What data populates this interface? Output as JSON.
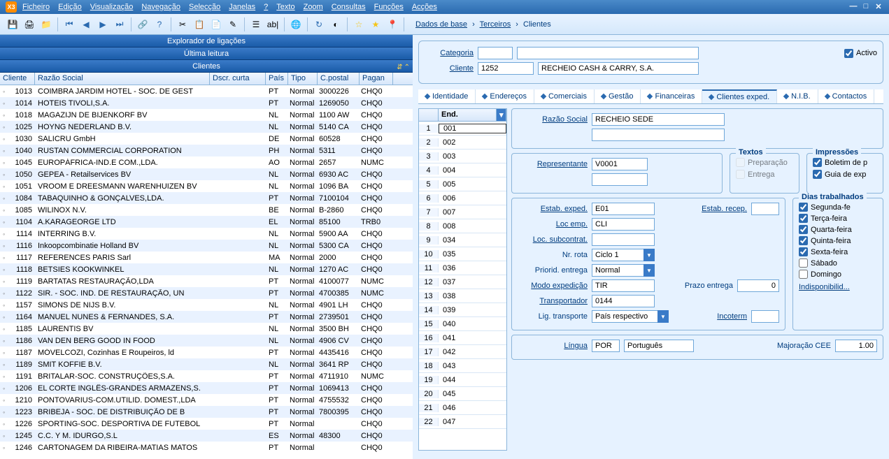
{
  "menu": [
    "Ficheiro",
    "Edição",
    "Visualização",
    "Navegação",
    "Selecção",
    "Janelas",
    "?",
    "Texto",
    "Zoom",
    "Consultas",
    "Funções",
    "Acções"
  ],
  "breadcrumb": {
    "a": "Dados de base",
    "b": "Terceiros",
    "c": "Clientes"
  },
  "leftHeaders": {
    "explorador": "Explorador de ligações",
    "leitura": "Última leitura",
    "clientes": "Clientes"
  },
  "gridCols": {
    "cliente": "Cliente",
    "razao": "Razão Social",
    "dscr": "Dscr. curta",
    "pais": "País",
    "tipo": "Tipo",
    "postal": "C.postal",
    "pagan": "Pagan"
  },
  "rows": [
    {
      "id": "1013",
      "razao": "COIMBRA JARDIM HOTEL - SOC. DE GEST",
      "pais": "PT",
      "tipo": "Normal",
      "postal": "3000226",
      "pag": "CHQ0"
    },
    {
      "id": "1014",
      "razao": "HOTEIS TIVOLI,S.A.",
      "pais": "PT",
      "tipo": "Normal",
      "postal": "1269050",
      "pag": "CHQ0"
    },
    {
      "id": "1018",
      "razao": "MAGAZIJN DE BIJENKORF BV",
      "pais": "NL",
      "tipo": "Normal",
      "postal": "1100 AW",
      "pag": "CHQ0"
    },
    {
      "id": "1025",
      "razao": "HOYNG NEDERLAND B.V.",
      "pais": "NL",
      "tipo": "Normal",
      "postal": "5140  CA",
      "pag": "CHQ0"
    },
    {
      "id": "1030",
      "razao": "SALICRU GmbH",
      "pais": "DE",
      "tipo": "Normal",
      "postal": "60528",
      "pag": "CHQ0"
    },
    {
      "id": "1040",
      "razao": "RUSTAN COMMERCIAL CORPORATION",
      "pais": "PH",
      "tipo": "Normal",
      "postal": "5311",
      "pag": "CHQ0"
    },
    {
      "id": "1045",
      "razao": "EUROPÁFRICA-IND.E COM.,LDA.",
      "pais": "AO",
      "tipo": "Normal",
      "postal": "2657",
      "pag": "NUMC"
    },
    {
      "id": "1050",
      "razao": "GEPEA - Retailservices BV",
      "pais": "NL",
      "tipo": "Normal",
      "postal": "6930 AC",
      "pag": "CHQ0"
    },
    {
      "id": "1051",
      "razao": "VROOM E DREESMANN WARENHUIZEN BV",
      "pais": "NL",
      "tipo": "Normal",
      "postal": "1096 BA",
      "pag": "CHQ0"
    },
    {
      "id": "1084",
      "razao": "TABAQUINHO & GONÇALVES,LDA.",
      "pais": "PT",
      "tipo": "Normal",
      "postal": "7100104",
      "pag": "CHQ0"
    },
    {
      "id": "1085",
      "razao": "WILINOX N.V.",
      "pais": "BE",
      "tipo": "Normal",
      "postal": "B-2860",
      "pag": "CHQ0"
    },
    {
      "id": "1104",
      "razao": "A.KARAGEORGE LTD",
      "pais": "EL",
      "tipo": "Normal",
      "postal": "85100",
      "pag": "TRB0"
    },
    {
      "id": "1114",
      "razao": "INTERRING B.V.",
      "pais": "NL",
      "tipo": "Normal",
      "postal": "5900 AA",
      "pag": "CHQ0"
    },
    {
      "id": "1116",
      "razao": "Inkoopcombinatie Holland BV",
      "pais": "NL",
      "tipo": "Normal",
      "postal": "5300 CA",
      "pag": "CHQ0"
    },
    {
      "id": "1117",
      "razao": "REFERENCES PARIS Sarl",
      "pais": "MA",
      "tipo": "Normal",
      "postal": "2000",
      "pag": "CHQ0"
    },
    {
      "id": "1118",
      "razao": "BETSIES KOOKWINKEL",
      "pais": "NL",
      "tipo": "Normal",
      "postal": "1270 AC",
      "pag": "CHQ0"
    },
    {
      "id": "1119",
      "razao": "BARTATAS RESTAURAÇÃO,LDA",
      "pais": "PT",
      "tipo": "Normal",
      "postal": "4100077",
      "pag": "NUMC"
    },
    {
      "id": "1122",
      "razao": "SIR. - SOC. IND. DE RESTAURAÇÃO, UN",
      "pais": "PT",
      "tipo": "Normal",
      "postal": "4700385",
      "pag": "NUMC"
    },
    {
      "id": "1157",
      "razao": "SIMONS DE NIJS B.V.",
      "pais": "NL",
      "tipo": "Normal",
      "postal": "4901 LH",
      "pag": "CHQ0"
    },
    {
      "id": "1164",
      "razao": "MANUEL NUNES & FERNANDES, S.A.",
      "pais": "PT",
      "tipo": "Normal",
      "postal": "2739501",
      "pag": "CHQ0"
    },
    {
      "id": "1185",
      "razao": "LAURENTIS BV",
      "pais": "NL",
      "tipo": "Normal",
      "postal": "3500 BH",
      "pag": "CHQ0"
    },
    {
      "id": "1186",
      "razao": "VAN DEN BERG  GOOD IN FOOD",
      "pais": "NL",
      "tipo": "Normal",
      "postal": "4906 CV",
      "pag": "CHQ0"
    },
    {
      "id": "1187",
      "razao": "MÓVELCOZI, Cozinhas E Roupeiros, ld",
      "pais": "PT",
      "tipo": "Normal",
      "postal": "4435416",
      "pag": "CHQ0"
    },
    {
      "id": "1189",
      "razao": "SMIT KOFFIE B.V.",
      "pais": "NL",
      "tipo": "Normal",
      "postal": "3641 RP",
      "pag": "CHQ0"
    },
    {
      "id": "1191",
      "razao": "BRITALAR-SOC. CONSTRUÇÕES,S.A.",
      "pais": "PT",
      "tipo": "Normal",
      "postal": "4711910",
      "pag": "NUMC"
    },
    {
      "id": "1206",
      "razao": "EL CORTE INGLÊS-GRANDES ARMAZENS,S.",
      "pais": "PT",
      "tipo": "Normal",
      "postal": "1069413",
      "pag": "CHQ0"
    },
    {
      "id": "1210",
      "razao": "PONTOVARIUS-COM.UTILID. DOMEST.,LDA",
      "pais": "PT",
      "tipo": "Normal",
      "postal": "4755532",
      "pag": "CHQ0"
    },
    {
      "id": "1223",
      "razao": "BRIBEJA - SOC. DE DISTRIBUIÇÃO DE B",
      "pais": "PT",
      "tipo": "Normal",
      "postal": "7800395",
      "pag": "CHQ0"
    },
    {
      "id": "1226",
      "razao": "SPORTING-SOC. DESPORTIVA DE FUTEBOL",
      "pais": "PT",
      "tipo": "Normal",
      "postal": "",
      "pag": "CHQ0"
    },
    {
      "id": "1245",
      "razao": "C.C. Y M. IDURGO,S.L",
      "pais": "ES",
      "tipo": "Normal",
      "postal": "48300",
      "pag": "CHQ0"
    },
    {
      "id": "1246",
      "razao": "CARTONAGEM DA RIBEIRA-MATIAS MATOS",
      "pais": "PT",
      "tipo": "Normal",
      "postal": "",
      "pag": "CHQ0"
    }
  ],
  "header": {
    "categoriaLbl": "Categoria",
    "clienteLbl": "Cliente",
    "clienteVal": "1252",
    "clienteNome": "RECHEIO CASH & CARRY, S.A.",
    "activoLbl": "Activo"
  },
  "tabs": [
    "Identidade",
    "Endereços",
    "Comerciais",
    "Gestão",
    "Financeiras",
    "Clientes exped.",
    "N.I.B.",
    "Contactos"
  ],
  "activeTab": 5,
  "addrHdr": "End.",
  "addrs": [
    {
      "n": "1",
      "v": "001"
    },
    {
      "n": "2",
      "v": "002"
    },
    {
      "n": "3",
      "v": "003"
    },
    {
      "n": "4",
      "v": "004"
    },
    {
      "n": "5",
      "v": "005"
    },
    {
      "n": "6",
      "v": "006"
    },
    {
      "n": "7",
      "v": "007"
    },
    {
      "n": "8",
      "v": "008"
    },
    {
      "n": "9",
      "v": "034"
    },
    {
      "n": "10",
      "v": "035"
    },
    {
      "n": "11",
      "v": "036"
    },
    {
      "n": "12",
      "v": "037"
    },
    {
      "n": "13",
      "v": "038"
    },
    {
      "n": "14",
      "v": "039"
    },
    {
      "n": "15",
      "v": "040"
    },
    {
      "n": "16",
      "v": "041"
    },
    {
      "n": "17",
      "v": "042"
    },
    {
      "n": "18",
      "v": "043"
    },
    {
      "n": "19",
      "v": "044"
    },
    {
      "n": "20",
      "v": "045"
    },
    {
      "n": "21",
      "v": "046"
    },
    {
      "n": "22",
      "v": "047"
    }
  ],
  "det": {
    "razaoLbl": "Razão Social",
    "razaoVal": "RECHEIO SEDE",
    "repLbl": "Representante",
    "repVal": "V0001",
    "textosLeg": "Textos",
    "prepLbl": "Preparação",
    "entrLbl": "Entrega",
    "imprLeg": "Impressões",
    "boletimLbl": "Boletim de p",
    "guiaLbl": "Guia de exp",
    "estabExpLbl": "Estab. exped.",
    "estabExpVal": "E01",
    "estabRecLbl": "Estab. recep.",
    "locEmpLbl": "Loc emp.",
    "locEmpVal": "CLI",
    "locSubLbl": "Loc. subcontrat.",
    "rotaLbl": "Nr. rota",
    "rotaVal": "Ciclo 1",
    "priorLbl": "Priorid. entrega",
    "priorVal": "Normal",
    "modoLbl": "Modo expedição",
    "modoVal": "TIR",
    "prazoLbl": "Prazo entrega",
    "prazoVal": "0",
    "transpLbl": "Transportador",
    "transpVal": "0144",
    "ligLbl": "Lig. transporte",
    "ligVal": "País respectivo",
    "incoLbl": "Incoterm",
    "diasLeg": "Dias trabalhados",
    "dias": [
      {
        "l": "Segunda-fe",
        "c": true
      },
      {
        "l": "Terça-feira",
        "c": true
      },
      {
        "l": "Quarta-feira",
        "c": true
      },
      {
        "l": "Quinta-feira",
        "c": true
      },
      {
        "l": "Sexta-feira",
        "c": true
      },
      {
        "l": "Sábado",
        "c": false
      },
      {
        "l": "Domingo",
        "c": false
      }
    ],
    "indispLbl": "Indisponibilid...",
    "linguaLbl": "Língua",
    "linguaVal": "POR",
    "linguaNome": "Português",
    "majorLbl": "Majoração CEE",
    "majorVal": "1.00"
  }
}
